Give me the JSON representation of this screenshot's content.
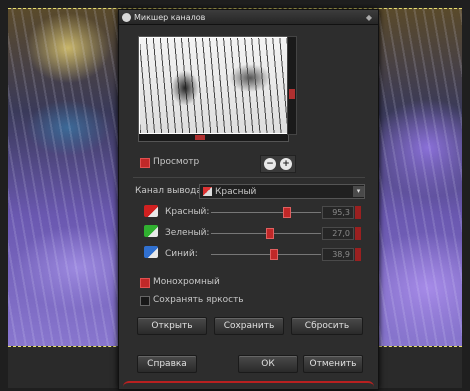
{
  "dialog": {
    "title": "Микшер каналов",
    "close_glyph": "◆"
  },
  "preview": {
    "checkbox_checked": true,
    "label": "Просмотр",
    "zoom_out_glyph": "−",
    "zoom_in_glyph": "+"
  },
  "output_channel": {
    "label": "Канал вывода:",
    "value": "Красный",
    "arrow_glyph": "▾"
  },
  "channels": [
    {
      "icon": "red-channel-icon",
      "color": "#d02020",
      "label": "Красный:",
      "value": "95,3",
      "fraction": 0.68
    },
    {
      "icon": "green-channel-icon",
      "color": "#30b030",
      "label": "Зеленый:",
      "value": "27,0",
      "fraction": 0.53
    },
    {
      "icon": "blue-channel-icon",
      "color": "#3070d0",
      "label": "Синий:",
      "value": "38,9",
      "fraction": 0.56
    }
  ],
  "options": {
    "monochrome_label": "Монохромный",
    "monochrome_checked": true,
    "preserve_label": "Сохранять яркость",
    "preserve_checked": false
  },
  "buttons": {
    "open": "Открыть",
    "save": "Сохранить",
    "reset": "Сбросить",
    "help": "Справка",
    "ok": "ОК",
    "cancel": "Отменить"
  },
  "colors": {
    "accent": "#c02828",
    "dialog_bg": "#2d2d2d"
  }
}
